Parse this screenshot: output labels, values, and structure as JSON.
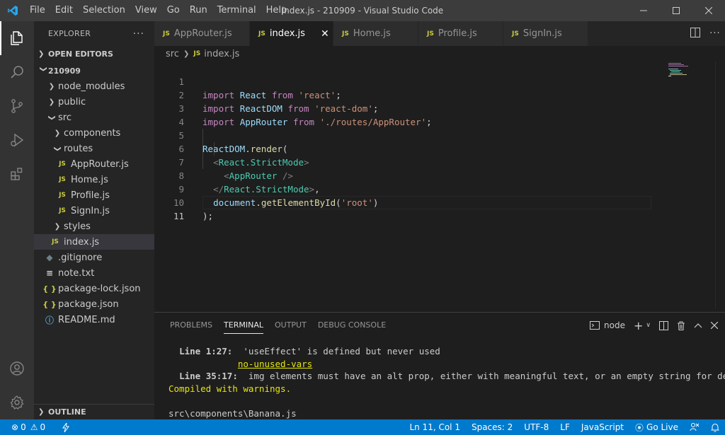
{
  "window": {
    "title": "index.js - 210909 - Visual Studio Code",
    "menu": [
      "File",
      "Edit",
      "Selection",
      "View",
      "Go",
      "Run",
      "Terminal",
      "Help"
    ]
  },
  "sidebar": {
    "header": "EXPLORER",
    "open_editors": "OPEN EDITORS",
    "project": "210909",
    "tree": [
      {
        "label": "node_modules",
        "type": "folder",
        "state": "collapsed",
        "depth": 1
      },
      {
        "label": "public",
        "type": "folder",
        "state": "collapsed",
        "depth": 1
      },
      {
        "label": "src",
        "type": "folder",
        "state": "expanded",
        "depth": 1
      },
      {
        "label": "components",
        "type": "folder",
        "state": "collapsed",
        "depth": 2
      },
      {
        "label": "routes",
        "type": "folder",
        "state": "expanded",
        "depth": 2
      },
      {
        "label": "AppRouter.js",
        "type": "js",
        "depth": 3
      },
      {
        "label": "Home.js",
        "type": "js",
        "depth": 3
      },
      {
        "label": "Profile.js",
        "type": "js",
        "depth": 3
      },
      {
        "label": "SignIn.js",
        "type": "js",
        "depth": 3
      },
      {
        "label": "styles",
        "type": "folder",
        "state": "collapsed",
        "depth": 2
      },
      {
        "label": "index.js",
        "type": "js",
        "depth": 2,
        "selected": true
      },
      {
        "label": ".gitignore",
        "type": "git",
        "depth": 1
      },
      {
        "label": "note.txt",
        "type": "txt",
        "depth": 1
      },
      {
        "label": "package-lock.json",
        "type": "json",
        "depth": 1
      },
      {
        "label": "package.json",
        "type": "json",
        "depth": 1
      },
      {
        "label": "README.md",
        "type": "md",
        "depth": 1
      }
    ],
    "outline": "OUTLINE"
  },
  "tabs": [
    {
      "label": "AppRouter.js",
      "active": false
    },
    {
      "label": "index.js",
      "active": true
    },
    {
      "label": "Home.js",
      "active": false
    },
    {
      "label": "Profile.js",
      "active": false
    },
    {
      "label": "SignIn.js",
      "active": false
    }
  ],
  "breadcrumb": {
    "folder": "src",
    "file": "index.js"
  },
  "editor": {
    "line_numbers": [
      "1",
      "2",
      "3",
      "4",
      "5",
      "6",
      "7",
      "8",
      "9",
      "10",
      "11"
    ],
    "current_line": 11
  },
  "panel": {
    "tabs": [
      "PROBLEMS",
      "TERMINAL",
      "OUTPUT",
      "DEBUG CONSOLE"
    ],
    "active_tab": "TERMINAL",
    "terminal_name": "node",
    "output": {
      "l1_loc": "Line 1:27:",
      "l1_msg": "  'useEffect' is defined but never used",
      "l1_rule": "no-unused-vars",
      "l2_loc": "Line 35:17:",
      "l2_msg": "  img elements must have an alt prop, either with meaningful text, or an empty string for decora",
      "l3": "Compiled with warnings.",
      "l4": "src\\components\\Banana.js"
    }
  },
  "statusbar": {
    "errors": "0",
    "warnings": "0",
    "position": "Ln 11, Col 1",
    "spaces": "Spaces: 2",
    "encoding": "UTF-8",
    "eol": "LF",
    "language": "JavaScript",
    "golive": "Go Live"
  },
  "colors": {
    "accent": "#007acc",
    "activitybar": "#333333",
    "sidebar": "#252526",
    "editor": "#1e1e1e",
    "js_icon": "#cbcb41"
  }
}
